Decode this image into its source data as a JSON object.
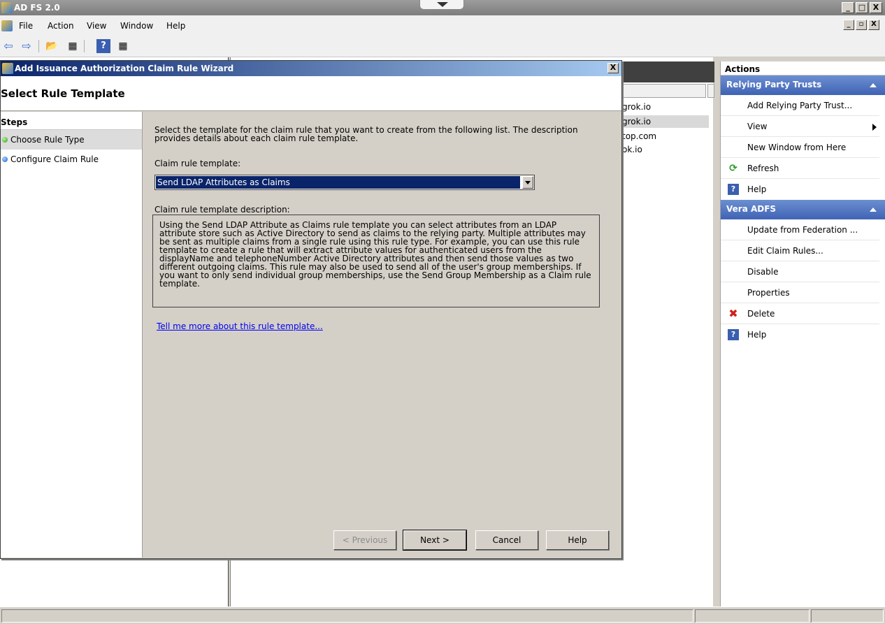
{
  "app": {
    "title": "AD FS 2.0",
    "min_label": "_",
    "max_label": "□",
    "close_label": "X"
  },
  "menu": {
    "items": [
      "File",
      "Action",
      "View",
      "Window",
      "Help"
    ],
    "mdi_min": "_",
    "mdi_restore": "▫",
    "mdi_close": "X"
  },
  "toolbar": {
    "back_icon": "⇦",
    "forward_icon": "⇨",
    "folder_icon": "📂",
    "grid_icon": "▦",
    "help_icon": "?",
    "grid2_icon": "▦"
  },
  "list": {
    "rows": [
      "grok.io",
      "grok.io",
      "top.com",
      "ok.io"
    ]
  },
  "actions": {
    "title": "Actions",
    "groups": [
      {
        "title": "Relying Party Trusts",
        "items": [
          {
            "label": "Add Relying Party Trust...",
            "icon": ""
          },
          {
            "label": "View",
            "icon": "",
            "submenu": true
          },
          {
            "label": "New Window from Here",
            "icon": ""
          },
          {
            "label": "Refresh",
            "icon": "⟳"
          },
          {
            "label": "Help",
            "icon": "?"
          }
        ]
      },
      {
        "title": "Vera ADFS",
        "items": [
          {
            "label": "Update from Federation ...",
            "icon": ""
          },
          {
            "label": "Edit Claim Rules...",
            "icon": ""
          },
          {
            "label": "Disable",
            "icon": ""
          },
          {
            "label": "Properties",
            "icon": ""
          },
          {
            "label": "Delete",
            "icon": "✖"
          },
          {
            "label": "Help",
            "icon": "?"
          }
        ]
      }
    ]
  },
  "wizard": {
    "title": "Add Issuance Authorization Claim Rule Wizard",
    "close_label": "X",
    "header": "Select Rule Template",
    "steps_title": "Steps",
    "steps": [
      "Choose Rule Type",
      "Configure Claim Rule"
    ],
    "instructions": "Select the template for the claim rule that you want to create from the following list. The description provides details about each claim rule template.",
    "template_label": "Claim rule template:",
    "template_value": "Send LDAP Attributes as Claims",
    "description_label": "Claim rule template description:",
    "description": "Using the Send LDAP Attribute as Claims rule template you can select attributes from an LDAP attribute store such as Active Directory to send as claims to the relying party. Multiple attributes may be sent as multiple claims from a single rule using this rule type. For example, you can use this rule template to create a rule that will extract attribute values for authenticated users from the displayName and telephoneNumber Active Directory attributes and then send those values as two different outgoing claims. This rule may also be used to send all of the user's group memberships. If you want to only send individual group memberships, use the Send Group Membership as a Claim rule template.",
    "tell_more": "Tell me more about this rule template...",
    "buttons": {
      "previous": "< Previous",
      "next": "Next >",
      "cancel": "Cancel",
      "help": "Help"
    }
  }
}
